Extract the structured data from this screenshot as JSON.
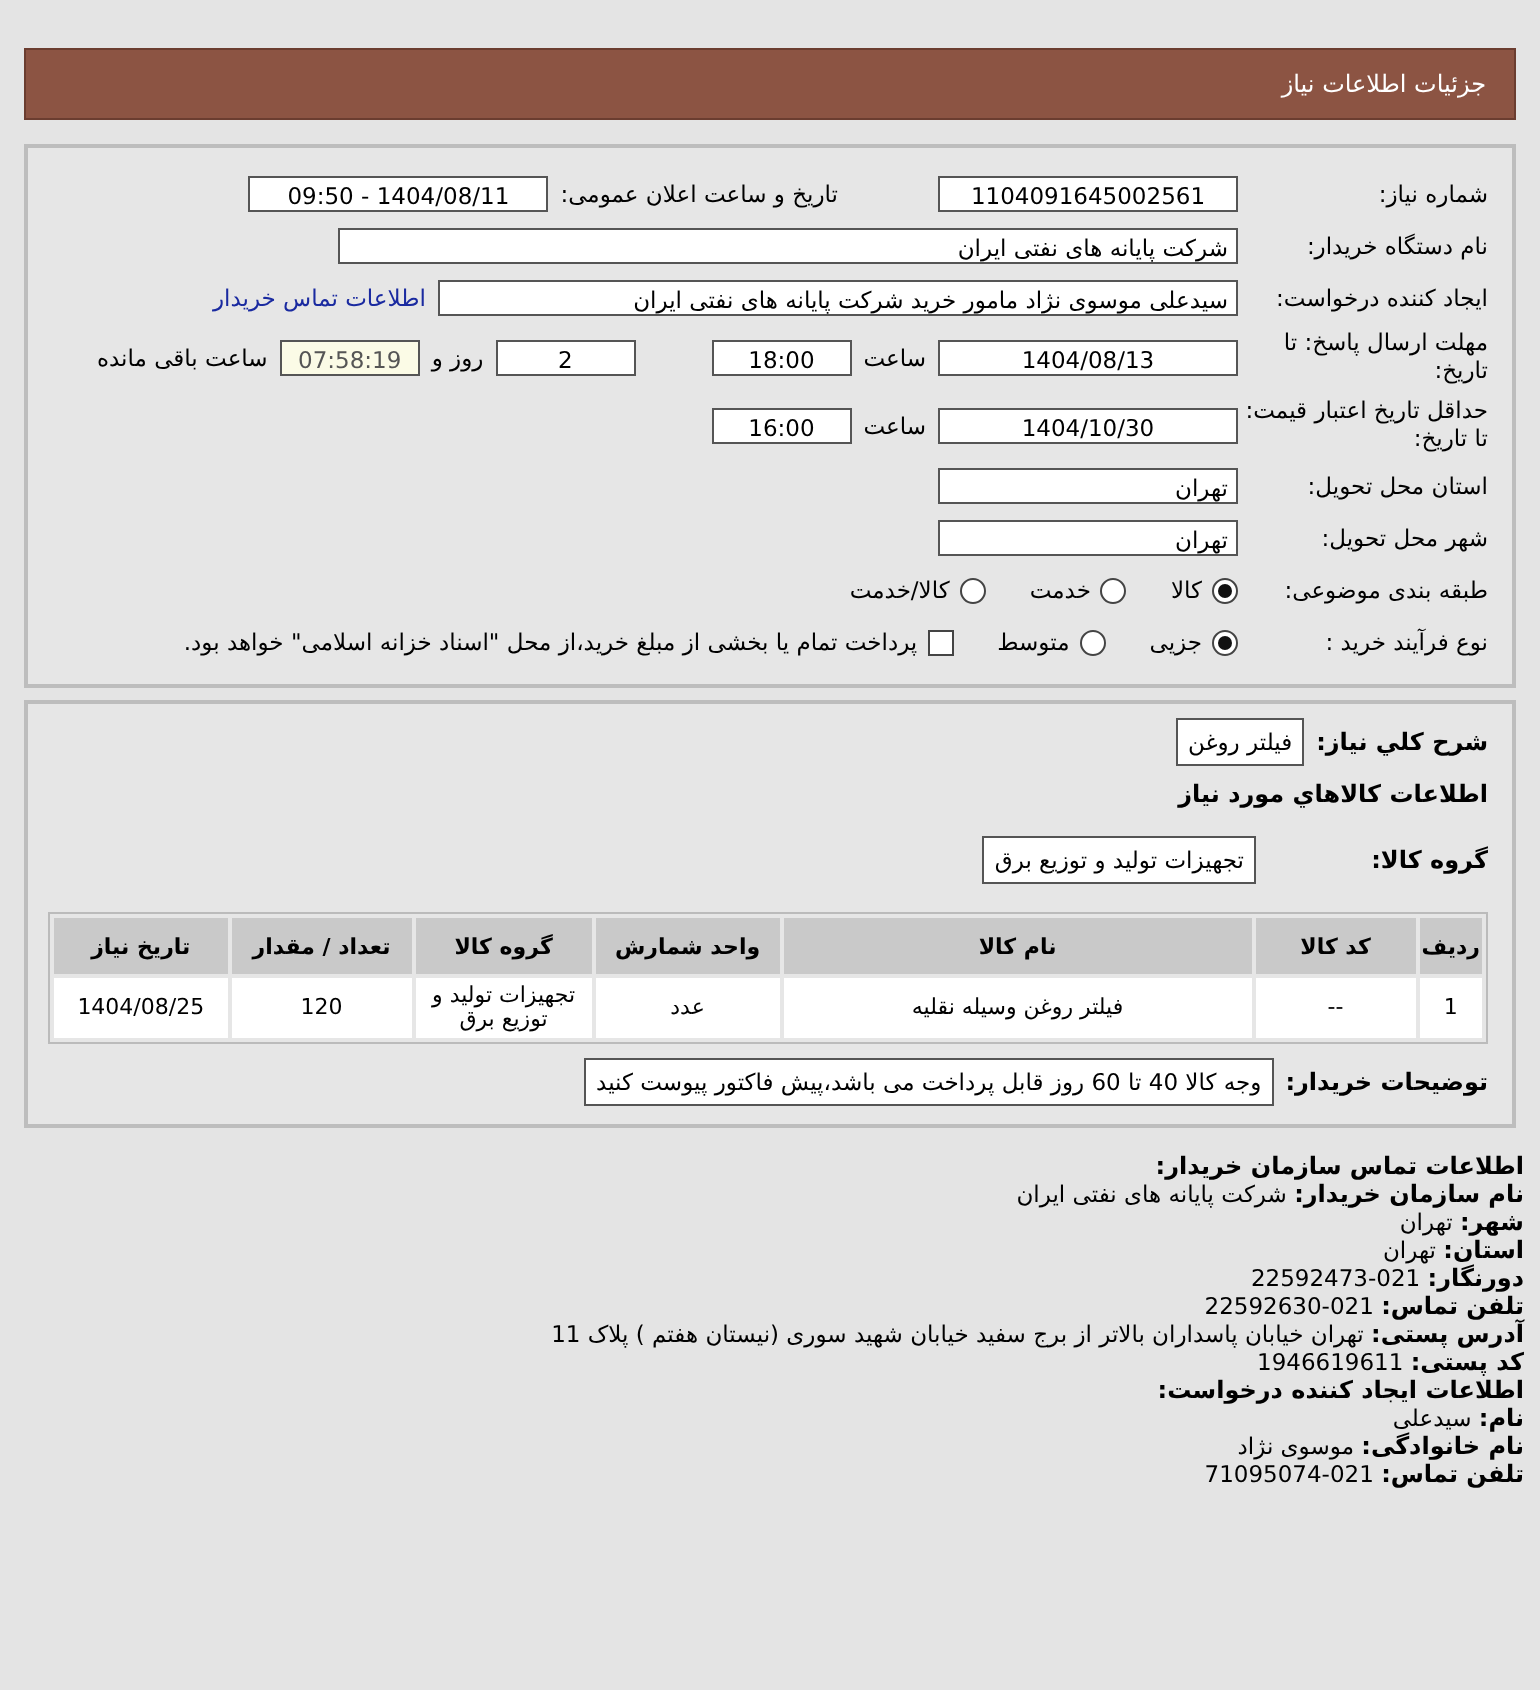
{
  "header": {
    "title": "جزئیات اطلاعات نیاز"
  },
  "form": {
    "need_number": {
      "label": "شماره نیاز:",
      "value": "1104091645002561"
    },
    "announce": {
      "label": "تاریخ و ساعت اعلان عمومی:",
      "value": "1404/08/11 - 09:50"
    },
    "buyer": {
      "label": "نام دستگاه خریدار:",
      "value": "شرکت پایانه های نفتی ایران"
    },
    "requester": {
      "label": "ایجاد کننده درخواست:",
      "value": "سیدعلی موسوی نژاد مامور خرید شرکت پایانه های نفتی ایران",
      "link": "اطلاعات تماس خریدار"
    },
    "deadline": {
      "label": "مهلت ارسال پاسخ: تا تاریخ:",
      "date": "1404/08/13",
      "time_label": "ساعت",
      "time": "18:00",
      "days": "2",
      "days_label": "روز و",
      "remaining": "07:58:19",
      "remaining_label": "ساعت باقی مانده"
    },
    "validity": {
      "label": "حداقل تاریخ اعتبار قیمت: تا تاریخ:",
      "date": "1404/10/30",
      "time_label": "ساعت",
      "time": "16:00"
    },
    "province": {
      "label": "استان محل تحویل:",
      "value": "تهران"
    },
    "city": {
      "label": "شهر محل تحویل:",
      "value": "تهران"
    },
    "category": {
      "label": "طبقه بندی موضوعی:",
      "options": [
        {
          "label": "کالا",
          "selected": true
        },
        {
          "label": "خدمت",
          "selected": false
        },
        {
          "label": "کالا/خدمت",
          "selected": false
        }
      ]
    },
    "process": {
      "label": "نوع فرآیند خرید :",
      "options": [
        {
          "label": "جزیی",
          "selected": true
        },
        {
          "label": "متوسط",
          "selected": false
        }
      ],
      "payment": {
        "checked": false,
        "label": "پرداخت تمام یا بخشی از مبلغ خرید،از محل \"اسناد خزانه اسلامی\" خواهد بود."
      }
    }
  },
  "details": {
    "summary": {
      "label": "شرح کلي نياز:",
      "value": "فیلتر روغن"
    },
    "goods_heading": "اطلاعات کالاهاي مورد نياز",
    "group": {
      "label": "گروه کالا:",
      "value": "تجهیزات تولید و توزیع برق"
    },
    "table": {
      "columns": [
        "ردیف",
        "کد کالا",
        "نام کالا",
        "واحد شمارش",
        "گروه کالا",
        "تعداد / مقدار",
        "تاریخ نیاز"
      ],
      "rows": [
        [
          "1",
          "--",
          "فیلتر روغن وسیله نقلیه",
          "عدد",
          "تجهیزات تولید و توزیع برق",
          "120",
          "1404/08/25"
        ]
      ]
    },
    "notes": {
      "label": "توضیحات خریدار:",
      "value": "وجه کالا 40 تا 60 روز قابل پرداخت می باشد،پیش فاکتور پیوست کنید"
    }
  },
  "contact": [
    {
      "kind": "heading",
      "label": "اطلاعات تماس سازمان خریدار:"
    },
    {
      "kind": "field",
      "label": "نام سازمان خریدار:",
      "value": "شرکت پایانه های نفتی ایران"
    },
    {
      "kind": "field",
      "label": "شهر:",
      "value": "تهران"
    },
    {
      "kind": "field",
      "label": "استان:",
      "value": "تهران"
    },
    {
      "kind": "field",
      "label": "دورنگار:",
      "value": "021-22592473"
    },
    {
      "kind": "field",
      "label": "تلفن تماس:",
      "value": "021-22592630"
    },
    {
      "kind": "field",
      "label": "آدرس پستی:",
      "value": "تهران خیابان پاسداران بالاتر از برج سفید خیابان شهید سوری (نیستان هفتم ) پلاک 11"
    },
    {
      "kind": "field",
      "label": "کد پستی:",
      "value": "1946619611"
    },
    {
      "kind": "heading",
      "label": "اطلاعات ایجاد کننده درخواست:"
    },
    {
      "kind": "field",
      "label": "نام:",
      "value": "سیدعلی"
    },
    {
      "kind": "field",
      "label": "نام خانوادگی:",
      "value": "موسوی نژاد"
    },
    {
      "kind": "field",
      "label": "تلفن تماس:",
      "value": "021-71095074"
    }
  ]
}
